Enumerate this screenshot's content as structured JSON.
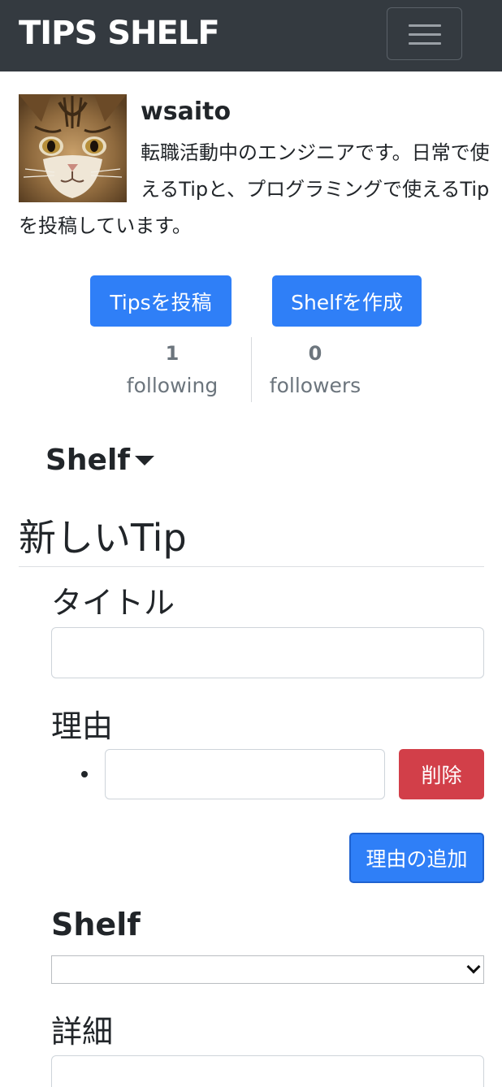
{
  "navbar": {
    "brand": "TIPS SHELF"
  },
  "profile": {
    "username": "wsaito",
    "bio": "転職活動中のエンジニアです。日常で使えるTipと、プログラミングで使えるTipを投稿しています。",
    "actions": {
      "post_tips": "Tipsを投稿",
      "create_shelf": "Shelfを作成"
    },
    "stats": {
      "following_count": "1",
      "following_label": "following",
      "followers_count": "0",
      "followers_label": "followers"
    }
  },
  "shelf_menu": {
    "label": "Shelf"
  },
  "form": {
    "heading": "新しいTip",
    "title_label": "タイトル",
    "title_value": "",
    "reason_label": "理由",
    "reasons": [
      ""
    ],
    "delete_label": "削除",
    "add_reason_label": "理由の追加",
    "shelf_label": "Shelf",
    "shelf_selected": "",
    "detail_label": "詳細",
    "detail_value": ""
  },
  "colors": {
    "navbar_bg": "#343a40",
    "primary": "#2f7ff7",
    "danger": "#d23f49",
    "muted": "#6c757d"
  }
}
